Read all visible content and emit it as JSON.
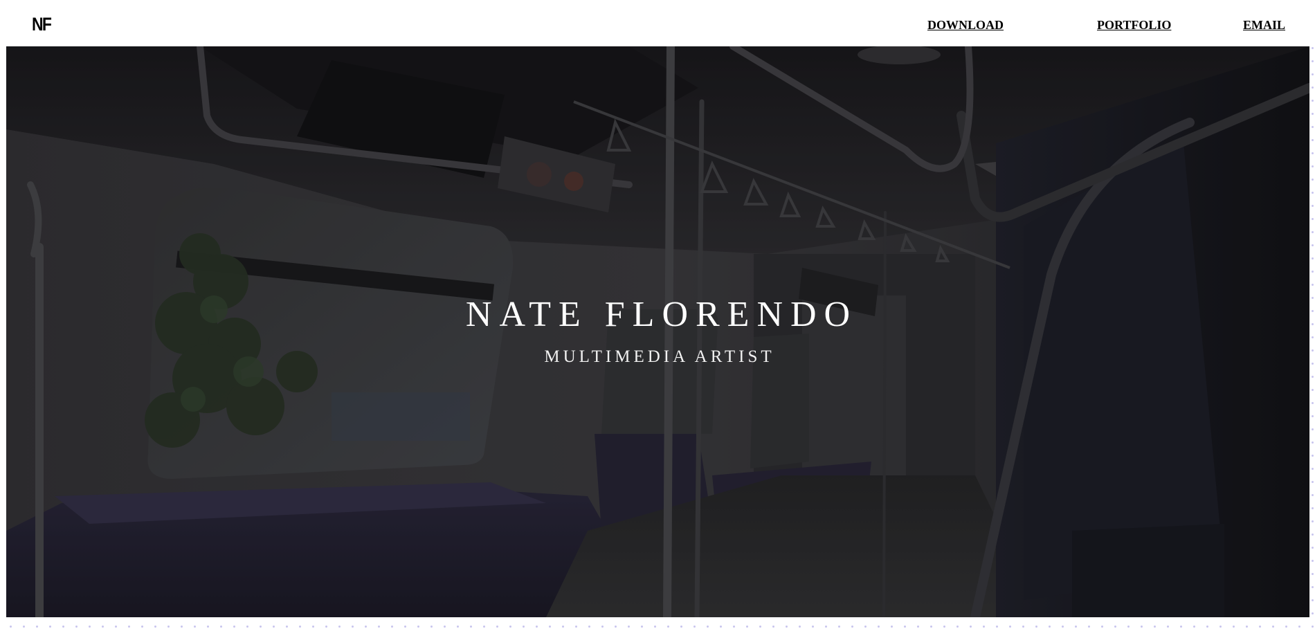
{
  "nav": {
    "logo": "NF",
    "links": [
      {
        "label": "DOWNLOAD"
      },
      {
        "label": "PORTFOLIO"
      },
      {
        "label": "EMAIL"
      }
    ]
  },
  "hero": {
    "title": "NATE FLORENDO",
    "subtitle": "MULTIMEDIA ARTIST",
    "background_description_colors": {
      "base": "#2b2a2e",
      "seat": "#2a2739",
      "foliage": "#3a4a32"
    }
  }
}
